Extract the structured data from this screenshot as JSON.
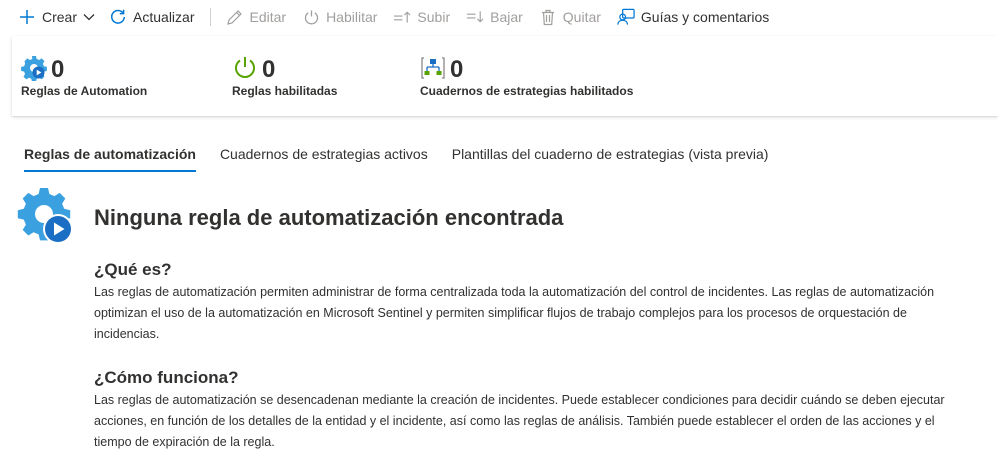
{
  "toolbar": {
    "create_label": "Crear",
    "refresh_label": "Actualizar",
    "edit_label": "Editar",
    "enable_label": "Habilitar",
    "up_label": "Subir",
    "down_label": "Bajar",
    "remove_label": "Quitar",
    "guides_label": "Guías y comentarios"
  },
  "summary": {
    "automation_rules": {
      "value": "0",
      "label": "Reglas de Automation"
    },
    "enabled_rules": {
      "value": "0",
      "label": "Reglas habilitadas"
    },
    "enabled_playbooks": {
      "value": "0",
      "label": "Cuadernos de estrategias habilitados"
    }
  },
  "tabs": [
    {
      "label": "Reglas de automatización",
      "active": true
    },
    {
      "label": "Cuadernos de estrategias activos",
      "active": false
    },
    {
      "label": "Plantillas del cuaderno de estrategias (vista previa)",
      "active": false
    }
  ],
  "empty_state": {
    "title": "Ninguna regla de automatización encontrada",
    "what_heading": "¿Qué es?",
    "what_text": "Las reglas de automatización permiten administrar de forma centralizada toda la automatización del control de incidentes. Las reglas de automatización optimizan el uso de la automatización en Microsoft Sentinel y permiten simplificar flujos de trabajo complejos para los procesos de orquestación de incidencias.",
    "how_heading": "¿Cómo funciona?",
    "how_text": "Las reglas de automatización se desencadenan mediante la creación de incidentes. Puede establecer condiciones para decidir cuándo se deben ejecutar acciones, en función de los detalles de la entidad y el incidente, así como las reglas de análisis. También puede establecer el orden de las acciones y el tiempo de expiración de la regla."
  },
  "colors": {
    "accent": "#0078d4",
    "gear": "#3aa0e0",
    "power_green": "#57a300",
    "disabled_text": "#a19f9d"
  }
}
